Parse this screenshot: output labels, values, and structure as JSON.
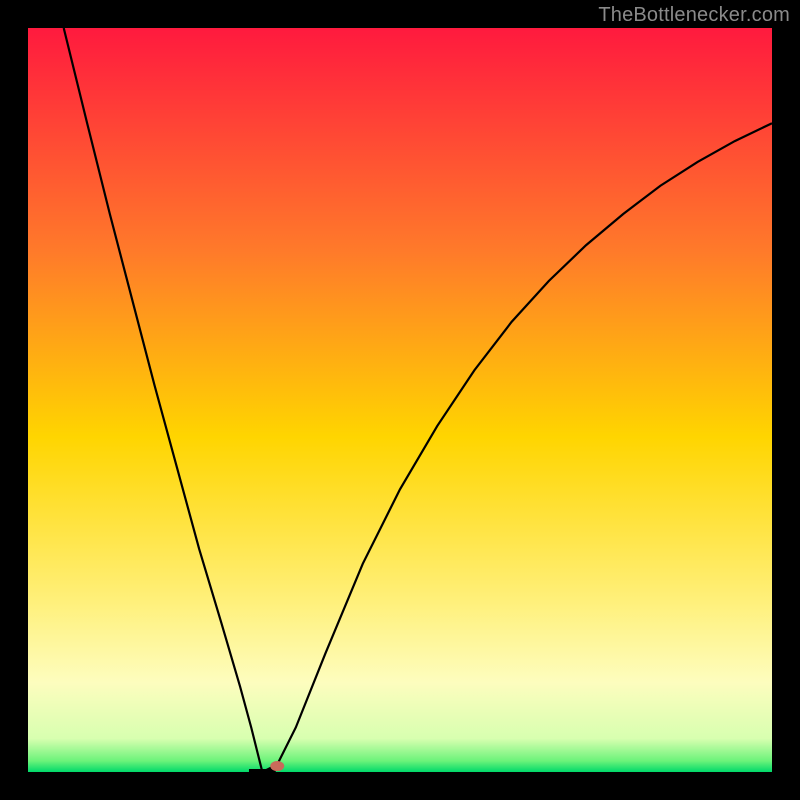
{
  "watermark": "TheBottlenecker.com",
  "chart_data": {
    "type": "line",
    "title": "",
    "xlabel": "",
    "ylabel": "",
    "xlim": [
      0,
      1
    ],
    "ylim": [
      0,
      1
    ],
    "grid": false,
    "legend": false,
    "gradient_stops": [
      {
        "pos": 0.0,
        "color": "#ff1a3e"
      },
      {
        "pos": 0.3,
        "color": "#ff7a2a"
      },
      {
        "pos": 0.55,
        "color": "#ffd500"
      },
      {
        "pos": 0.77,
        "color": "#fff07a"
      },
      {
        "pos": 0.88,
        "color": "#fdfdbe"
      },
      {
        "pos": 0.955,
        "color": "#d8ffb0"
      },
      {
        "pos": 0.985,
        "color": "#6cf37a"
      },
      {
        "pos": 1.0,
        "color": "#00d96a"
      }
    ],
    "curve": {
      "min_x": 0.315,
      "left": [
        {
          "x": 0.048,
          "y": 1.0
        },
        {
          "x": 0.08,
          "y": 0.87
        },
        {
          "x": 0.11,
          "y": 0.75
        },
        {
          "x": 0.14,
          "y": 0.635
        },
        {
          "x": 0.17,
          "y": 0.52
        },
        {
          "x": 0.2,
          "y": 0.41
        },
        {
          "x": 0.23,
          "y": 0.3
        },
        {
          "x": 0.26,
          "y": 0.2
        },
        {
          "x": 0.285,
          "y": 0.115
        },
        {
          "x": 0.3,
          "y": 0.06
        },
        {
          "x": 0.31,
          "y": 0.02
        },
        {
          "x": 0.315,
          "y": 0.0
        }
      ],
      "right": [
        {
          "x": 0.315,
          "y": 0.0
        },
        {
          "x": 0.335,
          "y": 0.01
        },
        {
          "x": 0.36,
          "y": 0.06
        },
        {
          "x": 0.4,
          "y": 0.16
        },
        {
          "x": 0.45,
          "y": 0.28
        },
        {
          "x": 0.5,
          "y": 0.38
        },
        {
          "x": 0.55,
          "y": 0.465
        },
        {
          "x": 0.6,
          "y": 0.54
        },
        {
          "x": 0.65,
          "y": 0.605
        },
        {
          "x": 0.7,
          "y": 0.66
        },
        {
          "x": 0.75,
          "y": 0.708
        },
        {
          "x": 0.8,
          "y": 0.75
        },
        {
          "x": 0.85,
          "y": 0.788
        },
        {
          "x": 0.9,
          "y": 0.82
        },
        {
          "x": 0.95,
          "y": 0.848
        },
        {
          "x": 1.0,
          "y": 0.872
        }
      ]
    },
    "marker": {
      "x": 0.335,
      "y": 0.008,
      "color": "#c96a5a",
      "rx": 7,
      "ry": 5
    }
  }
}
